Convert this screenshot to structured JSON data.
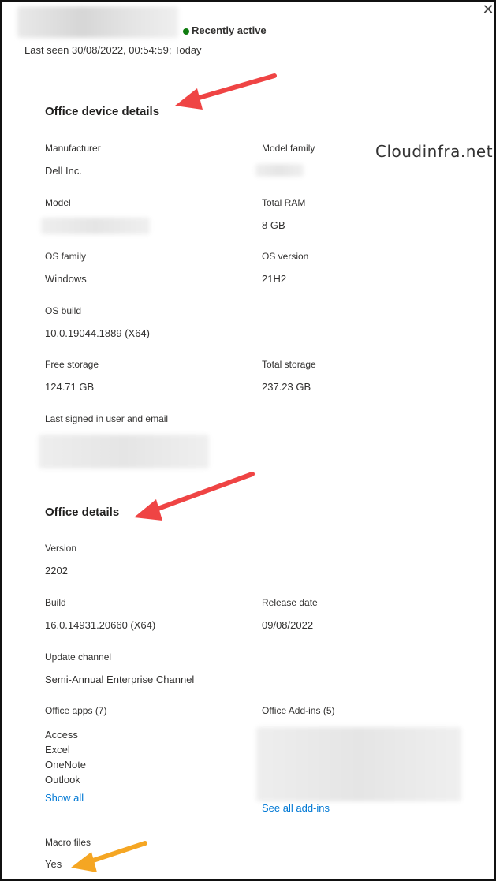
{
  "header": {
    "status": "Recently active",
    "last_seen": "Last seen 30/08/2022, 00:54:59; Today",
    "close_glyph": "✕",
    "status_color": "#107c10"
  },
  "watermark": "Cloudinfra.net",
  "device_section": {
    "title": "Office device details",
    "manufacturer_label": "Manufacturer",
    "manufacturer_value": "Dell Inc.",
    "model_family_label": "Model family",
    "model_label": "Model",
    "total_ram_label": "Total RAM",
    "total_ram_value": "8 GB",
    "os_family_label": "OS family",
    "os_family_value": "Windows",
    "os_version_label": "OS version",
    "os_version_value": "21H2",
    "os_build_label": "OS build",
    "os_build_value": "10.0.19044.1889 (X64)",
    "free_storage_label": "Free storage",
    "free_storage_value": "124.71 GB",
    "total_storage_label": "Total storage",
    "total_storage_value": "237.23 GB",
    "last_user_label": "Last signed in user and email"
  },
  "office_section": {
    "title": "Office details",
    "version_label": "Version",
    "version_value": "2202",
    "build_label": "Build",
    "build_value": "16.0.14931.20660 (X64)",
    "release_date_label": "Release date",
    "release_date_value": "09/08/2022",
    "update_channel_label": "Update channel",
    "update_channel_value": "Semi-Annual Enterprise Channel",
    "office_apps_label": "Office apps (7)",
    "office_apps": [
      "Access",
      "Excel",
      "OneNote",
      "Outlook"
    ],
    "show_all_link": "Show all",
    "addins_label": "Office Add-ins (5)",
    "see_all_addins_link": "See all add-ins",
    "macro_label": "Macro files",
    "macro_value": "Yes"
  },
  "colors": {
    "red_arrow": "#ef4444",
    "orange_arrow": "#f5a623",
    "link": "#0078d4"
  }
}
